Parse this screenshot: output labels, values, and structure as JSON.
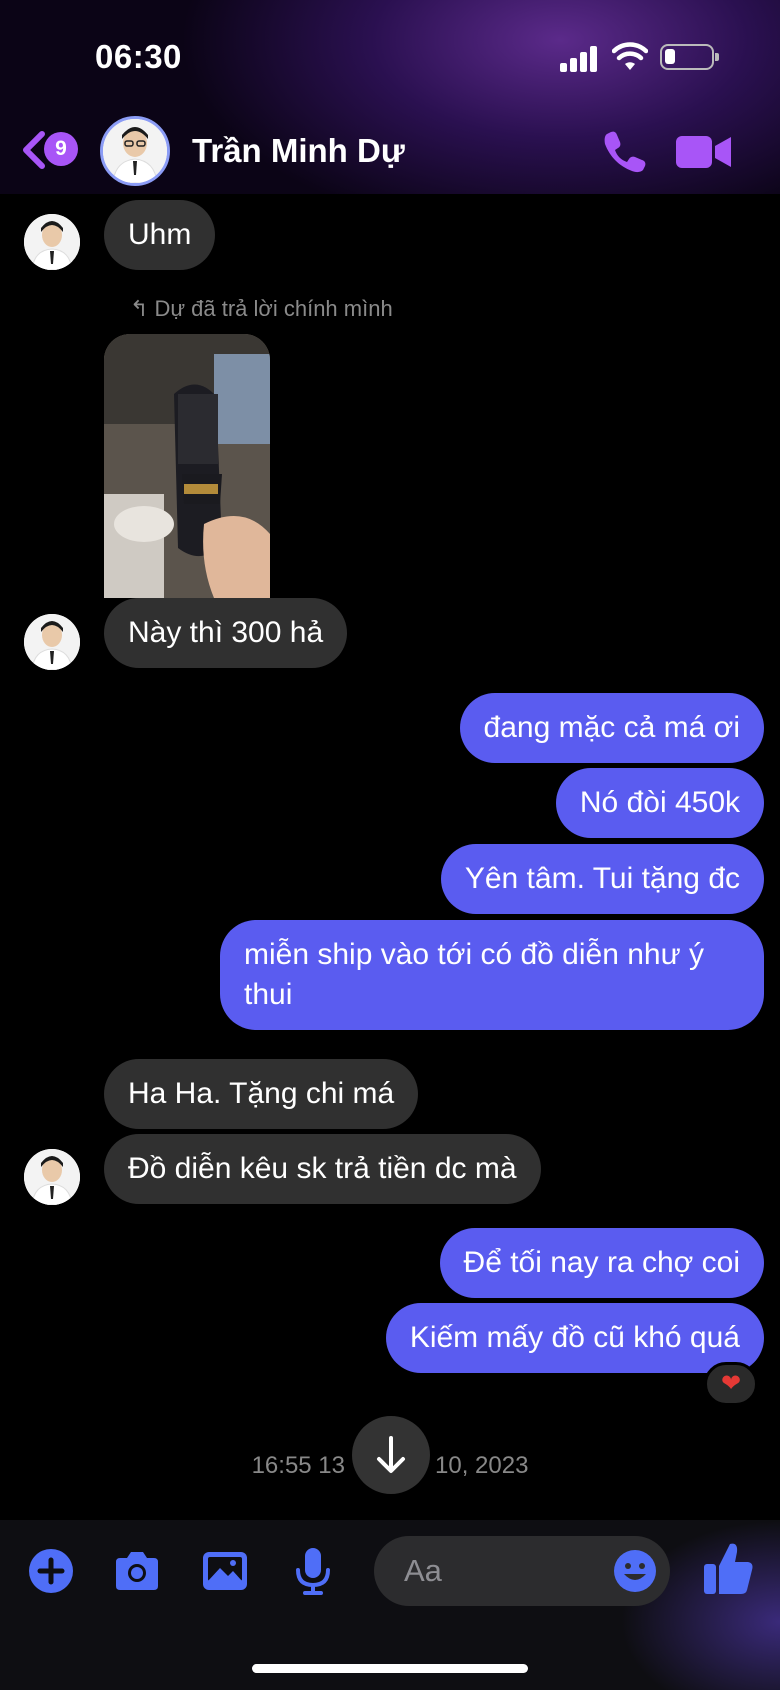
{
  "status_bar": {
    "time": "06:30"
  },
  "header": {
    "back_badge": "9",
    "contact_name": "Trần Minh Dự"
  },
  "messages": [
    {
      "dir": "in",
      "text": "Uhm"
    },
    {
      "reply_note": "Dự đã trả lời chính mình"
    },
    {
      "dir": "in",
      "text": "Này thì 300 hả"
    },
    {
      "dir": "out",
      "text": "đang mặc cả má ơi"
    },
    {
      "dir": "out",
      "text": "Nó đòi 450k"
    },
    {
      "dir": "out",
      "text": "Yên tâm. Tui tặng đc"
    },
    {
      "dir": "out",
      "text": "miễn ship vào tới có đồ diễn như ý thui"
    },
    {
      "dir": "in",
      "text": "Ha Ha. Tặng chi má"
    },
    {
      "dir": "in",
      "text": "Đồ diễn kêu sk trả tiền dc mà"
    },
    {
      "dir": "out",
      "text": "Để tối nay ra chợ coi"
    },
    {
      "dir": "out",
      "text": "Kiếm mấy đồ cũ khó quá"
    }
  ],
  "reaction": "❤",
  "timestamp": {
    "left": "16:55 13",
    "right": "10, 2023"
  },
  "composer": {
    "placeholder": "Aa"
  },
  "colors": {
    "outgoing": "#5a5cf0",
    "incoming": "#303030",
    "accent": "#a855f7",
    "icon": "#4f6ef7"
  },
  "icons": [
    "back-chevron-icon",
    "phone-icon",
    "video-icon",
    "plus-icon",
    "camera-icon",
    "image-icon",
    "mic-icon",
    "emoji-icon",
    "thumbs-up-icon",
    "arrow-down-icon"
  ]
}
